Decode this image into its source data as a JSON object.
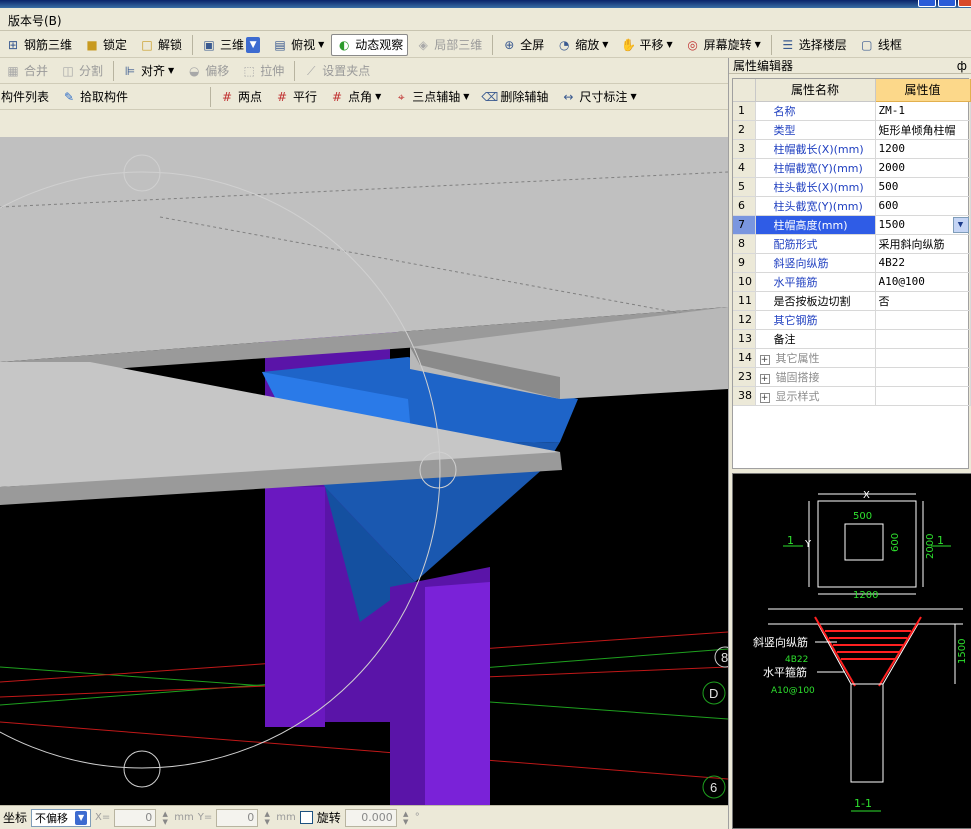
{
  "menu": {
    "version": "版本号(B)"
  },
  "toolbar1": {
    "rebar3d": "钢筋三维",
    "lock": "锁定",
    "unlock": "解锁",
    "view_mode": "三维",
    "topview": "俯视",
    "dynamic": "动态观察",
    "local3d": "局部三维",
    "fullscreen": "全屏",
    "zoom": "缩放",
    "pan": "平移",
    "rotate": "屏幕旋转",
    "select_floor": "选择楼层",
    "wireframe": "线框"
  },
  "toolbar2": {
    "merge": "合并",
    "split": "分割",
    "align": "对齐",
    "offset": "偏移",
    "stretch": "拉伸",
    "set_grip": "设置夹点"
  },
  "toolbar3": {
    "component_list": "构件列表",
    "pick_component": "拾取构件",
    "two_points": "两点",
    "parallel": "平行",
    "point_angle": "点角",
    "three_point_axis": "三点辅轴",
    "delete_axis": "删除辅轴",
    "dimension": "尺寸标注"
  },
  "viewport": {
    "axis_labels": [
      "8",
      "D",
      "6"
    ]
  },
  "status": {
    "coord_label": "坐标",
    "offset_mode": "不偏移",
    "x_label": "X=",
    "x_value": "0",
    "unit": "mm",
    "y_label": "Y=",
    "y_value": "0",
    "rotate_label": "旋转",
    "rotate_value": "0.000",
    "degree": "°"
  },
  "panel": {
    "title": "属性编辑器",
    "pin": "ф",
    "col_name": "属性名称",
    "col_value": "属性值",
    "rows": [
      {
        "no": "1",
        "name": "名称",
        "value": "ZM-1"
      },
      {
        "no": "2",
        "name": "类型",
        "value": "矩形单倾角柱帽"
      },
      {
        "no": "3",
        "name": "柱帽截长(X)(mm)",
        "value": "1200"
      },
      {
        "no": "4",
        "name": "柱帽截宽(Y)(mm)",
        "value": "2000"
      },
      {
        "no": "5",
        "name": "柱头截长(X)(mm)",
        "value": "500"
      },
      {
        "no": "6",
        "name": "柱头截宽(Y)(mm)",
        "value": "600"
      },
      {
        "no": "7",
        "name": "柱帽高度(mm)",
        "value": "1500"
      },
      {
        "no": "8",
        "name": "配筋形式",
        "value": "采用斜向纵筋"
      },
      {
        "no": "9",
        "name": "斜竖向纵筋",
        "value": "4B22"
      },
      {
        "no": "10",
        "name": "水平箍筋",
        "value": "A10@100"
      },
      {
        "no": "11",
        "name": "是否按板边切割",
        "value": "否"
      },
      {
        "no": "12",
        "name": "其它钢筋",
        "value": ""
      },
      {
        "no": "13",
        "name": "备注",
        "value": ""
      },
      {
        "no": "14",
        "name": "其它属性",
        "value": ""
      },
      {
        "no": "23",
        "name": "锚固搭接",
        "value": ""
      },
      {
        "no": "38",
        "name": "显示样式",
        "value": ""
      }
    ]
  },
  "preview": {
    "dim_x": "X",
    "dim_y": "Y",
    "head_x": "500",
    "head_y": "600",
    "cap_y": "2000",
    "cap_x": "1200",
    "height": "1500",
    "section_mark": "1",
    "section_title": "1-1",
    "diag_rebar": "斜竖向纵筋",
    "diag_rebar_val": "4B22",
    "hoop": "水平箍筋",
    "hoop_val": "A10@100"
  },
  "colors": {
    "slab": "#c0c0c0",
    "cap": "#1e64c8",
    "column": "#6a18c0",
    "selected_row": "#2f5ce6",
    "header_value": "#fcd88a"
  }
}
